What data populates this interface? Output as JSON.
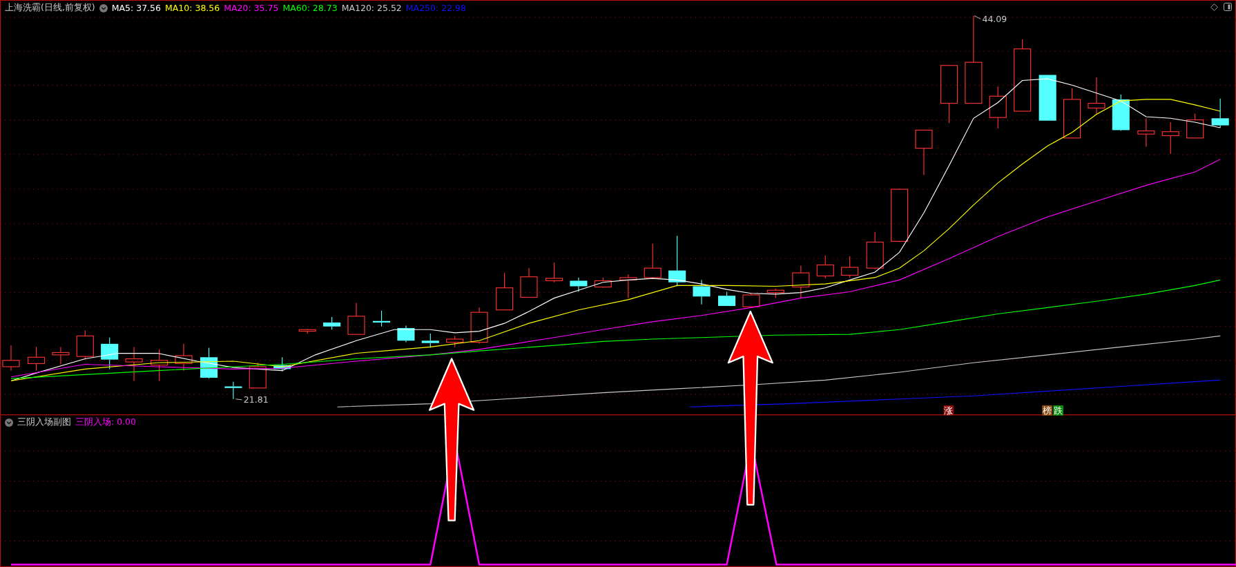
{
  "title": {
    "name": "上海洗霸(日线,前复权)"
  },
  "ma_legend": [
    {
      "label": "MA5: 37.56",
      "color": "#ffffff"
    },
    {
      "label": "MA10: 38.56",
      "color": "#ffff00"
    },
    {
      "label": "MA20: 35.75",
      "color": "#ff00ff"
    },
    {
      "label": "MA60: 28.73",
      "color": "#00ff00"
    },
    {
      "label": "MA120: 25.52",
      "color": "#c8c8c8"
    },
    {
      "label": "MA250: 22.98",
      "color": "#1010ff"
    }
  ],
  "price_labels": [
    {
      "text": "44.09",
      "kind": "high"
    },
    {
      "text": "21.81",
      "kind": "low"
    }
  ],
  "markers": [
    {
      "text": "涨",
      "color": "#8b0a0a"
    },
    {
      "text": "榜",
      "color": "#8a4a10"
    },
    {
      "text": "跌",
      "color": "#0a8a0a"
    }
  ],
  "indicator": {
    "name": "三阴入场副图",
    "legend": "三阴入场: 0.00",
    "color": "#ff00ff"
  }
}
